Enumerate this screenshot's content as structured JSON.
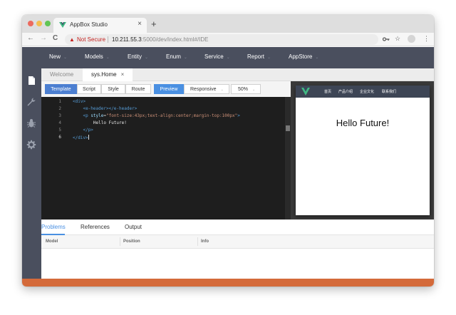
{
  "browser": {
    "tab_title": "AppBox Studio",
    "tab_close": "×",
    "new_tab": "+",
    "security_label": "Not Secure",
    "url_host": "10.211.55.3",
    "url_path": ":5000/dev/index.html#/IDE",
    "back": "←",
    "forward": "→",
    "reload": "C",
    "key_icon": "key-icon",
    "star_icon": "star-icon",
    "more_icon": "⋮"
  },
  "topnav": {
    "items": [
      {
        "label": "New"
      },
      {
        "label": "Models"
      },
      {
        "label": "Entity"
      },
      {
        "label": "Enum"
      },
      {
        "label": "Service"
      },
      {
        "label": "Report"
      },
      {
        "label": "AppStore"
      }
    ]
  },
  "sidebar": {
    "icons": [
      "file-icon",
      "wrench-icon",
      "bug-icon",
      "gear-icon"
    ]
  },
  "workspace_tabs": [
    {
      "label": "Welcome"
    },
    {
      "label": "sys.Home",
      "close": "×"
    }
  ],
  "toolbar": {
    "view_tabs": [
      "Template",
      "Script",
      "Style",
      "Route"
    ],
    "preview": "Preview",
    "device": "Responsive",
    "zoom": "50%"
  },
  "editor": {
    "line_numbers": [
      "1",
      "2",
      "3",
      "4",
      "5",
      "6"
    ],
    "current_line": "6"
  },
  "preview": {
    "nav_items": [
      "首页",
      "产品介绍",
      "企业文化",
      "联系我们"
    ],
    "hello": "Hello Future!"
  },
  "bottom_panel": {
    "tabs": [
      "Problems",
      "References",
      "Output"
    ],
    "columns": [
      "Model",
      "Position",
      "Info"
    ]
  },
  "colors": {
    "nav_bg": "#4a4f5e",
    "editor_bg": "#1e1e1e",
    "accent": "#4a90e2",
    "footer": "#d46a3a"
  }
}
